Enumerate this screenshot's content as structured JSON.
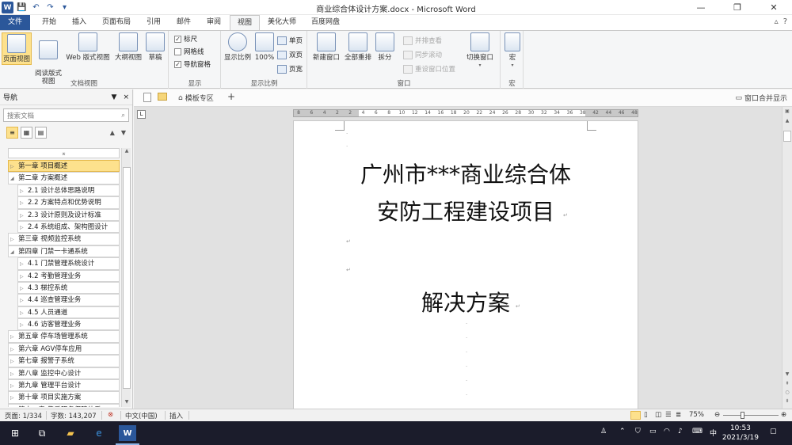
{
  "window": {
    "title": "商业综合体设计方案.docx - Microsoft Word",
    "app_icon": "W",
    "minimize": "—",
    "restore": "❐",
    "close": "✕"
  },
  "ribbon_tabs": [
    "文件",
    "开始",
    "插入",
    "页面布局",
    "引用",
    "邮件",
    "审阅",
    "视图",
    "美化大师",
    "百度网盘"
  ],
  "active_tab": "视图",
  "groups": {
    "doc_views": {
      "label": "文档视图",
      "buttons": [
        "页面视图",
        "阅读版式\n视图",
        "Web 版式视图",
        "大纲视图",
        "草稿"
      ]
    },
    "show": {
      "label": "显示",
      "items": [
        {
          "label": "标尺",
          "checked": true
        },
        {
          "label": "网格线",
          "checked": false
        },
        {
          "label": "导航窗格",
          "checked": true
        }
      ]
    },
    "zoom": {
      "label": "显示比例",
      "buttons": [
        "显示比例",
        "100%"
      ],
      "small": [
        "单页",
        "双页",
        "页宽"
      ]
    },
    "window": {
      "label": "窗口",
      "buttons": [
        "新建窗口",
        "全部重排",
        "拆分",
        "切换窗口"
      ],
      "small": [
        "并排查看",
        "同步滚动",
        "重设窗口位置"
      ]
    },
    "macro": {
      "label": "宏",
      "buttons": [
        "宏"
      ]
    }
  },
  "nav": {
    "title": "导航",
    "close": "×",
    "pin": "▼",
    "search_placeholder": "搜索文档",
    "items": [
      {
        "text": "第一章 项目概述",
        "level": 1,
        "selected": true,
        "tri": "▷"
      },
      {
        "text": "第二章 方案概述",
        "level": 1,
        "selected": false,
        "tri": "◢"
      },
      {
        "text": "2.1 设计总体思路说明",
        "level": 2,
        "selected": false,
        "tri": "▷"
      },
      {
        "text": "2.2 方案特点和优势说明",
        "level": 2,
        "selected": false,
        "tri": "▷"
      },
      {
        "text": "2.3 设计原则及设计标准",
        "level": 2,
        "selected": false,
        "tri": "▷"
      },
      {
        "text": "2.4 系统组成、架构图设计",
        "level": 2,
        "selected": false,
        "tri": "▷"
      },
      {
        "text": "第三章 视频监控系统",
        "level": 1,
        "selected": false,
        "tri": "▷"
      },
      {
        "text": "第四章 门禁一卡通系统",
        "level": 1,
        "selected": false,
        "tri": "◢"
      },
      {
        "text": "4.1 门禁管理系统设计",
        "level": 2,
        "selected": false,
        "tri": "▷"
      },
      {
        "text": "4.2 考勤管理业务",
        "level": 2,
        "selected": false,
        "tri": "▷"
      },
      {
        "text": "4.3 梯控系统",
        "level": 2,
        "selected": false,
        "tri": "▷"
      },
      {
        "text": "4.4 巡查管理业务",
        "level": 2,
        "selected": false,
        "tri": "▷"
      },
      {
        "text": "4.5 人员通道",
        "level": 2,
        "selected": false,
        "tri": "▷"
      },
      {
        "text": "4.6 访客管理业务",
        "level": 2,
        "selected": false,
        "tri": "▷"
      },
      {
        "text": "第五章 停车场管理系统",
        "level": 1,
        "selected": false,
        "tri": "▷"
      },
      {
        "text": "第六章 AGV停车应用",
        "level": 1,
        "selected": false,
        "tri": "▷"
      },
      {
        "text": "第七章 报警子系统",
        "level": 1,
        "selected": false,
        "tri": "▷"
      },
      {
        "text": "第八章 监控中心设计",
        "level": 1,
        "selected": false,
        "tri": "▷"
      },
      {
        "text": "第九章 管理平台设计",
        "level": 1,
        "selected": false,
        "tri": "▷"
      },
      {
        "text": "第十章 项目实施方案",
        "level": 1,
        "selected": false,
        "tri": "▷"
      },
      {
        "text": "第十一章 售后服务保障体系",
        "level": 1,
        "selected": false,
        "tri": "▷"
      }
    ]
  },
  "doc_tabs": {
    "template_area": "模板专区",
    "add": "+",
    "merge_windows": "窗口合并显示"
  },
  "ruler_numbers": [
    "8",
    "6",
    "4",
    "2",
    "2",
    "4",
    "6",
    "8",
    "10",
    "12",
    "14",
    "16",
    "18",
    "20",
    "22",
    "24",
    "26",
    "28",
    "30",
    "32",
    "34",
    "36",
    "38",
    "42",
    "44",
    "46",
    "48"
  ],
  "document": {
    "line1": "广州市***商业综合体",
    "line2": "安防工程建设项目",
    "line3": "解决方案"
  },
  "status": {
    "page": "页面: 1/334",
    "words": "字数: 143,207",
    "language": "中文(中国)",
    "mode": "插入",
    "zoom": "75%",
    "zoom_level_percent": 75
  },
  "taskbar": {
    "time": "10:53",
    "date": "2021/3/19",
    "ime": "中"
  }
}
